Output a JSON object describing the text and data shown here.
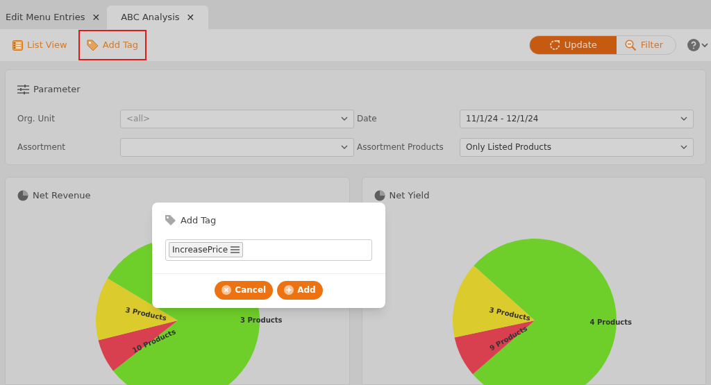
{
  "tabs": [
    {
      "label": "Edit Menu Entries",
      "close": "✕",
      "selected": false
    },
    {
      "label": "ABC Analysis",
      "close": "✕",
      "selected": true
    }
  ],
  "toolbar": {
    "left": [
      {
        "kind": "list",
        "label": "List View",
        "highlighted": false
      },
      {
        "kind": "tag",
        "label": "Add Tag",
        "highlighted": true
      }
    ],
    "update": "Update",
    "filter": "Filter"
  },
  "parameter": {
    "title": "Parameter",
    "fields": [
      {
        "label": "Org. Unit",
        "placeholder": "<all>"
      },
      {
        "label": "Date",
        "value": "11/1/24 - 12/1/24"
      },
      {
        "label": "Assortment"
      },
      {
        "label": "Assortment Products",
        "value": "Only Listed Products"
      }
    ]
  },
  "charts": [
    {
      "title": "Net Revenue",
      "slices": [
        {
          "label": "3 Products",
          "color": "#6fcf2a"
        },
        {
          "label": "10 Products",
          "color": "#d9404f"
        },
        {
          "label": "3 Products",
          "color": "#dccb2c"
        }
      ]
    },
    {
      "title": "Net Yield",
      "slices": [
        {
          "label": "4 Products",
          "color": "#6fcf2a"
        },
        {
          "label": "9 Products",
          "color": "#d9404f"
        },
        {
          "label": "3 Products",
          "color": "#dccb2c"
        }
      ]
    }
  ],
  "dialog": {
    "title": "Add Tag",
    "tags": [
      "IncreasePrice"
    ],
    "buttons": [
      {
        "kind": "cancel",
        "label": "Cancel"
      },
      {
        "kind": "add",
        "label": "Add"
      }
    ]
  }
}
